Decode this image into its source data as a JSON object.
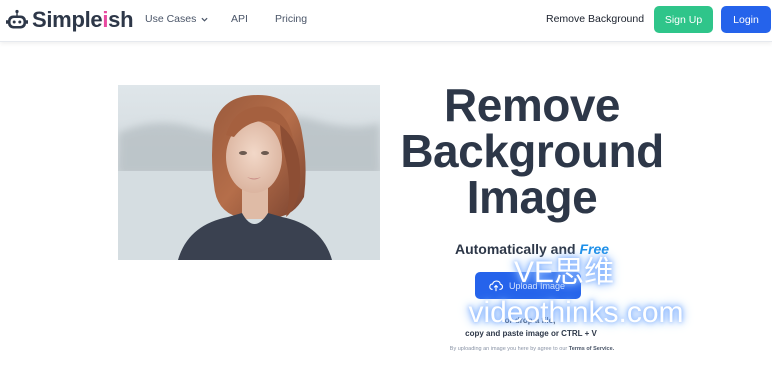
{
  "nav": {
    "logo_prefix": "Simple",
    "logo_i": "i",
    "logo_suffix": "sh",
    "use_cases": "Use Cases",
    "api": "API",
    "pricing": "Pricing",
    "remove_background": "Remove Background",
    "sign_up": "Sign Up",
    "login": "Login"
  },
  "hero": {
    "title_line1": "Remove",
    "title_line2": "Background",
    "title_line3": "Image",
    "subtitle_prefix": "Automatically and",
    "subtitle_free": "Free",
    "upload_label": "Upload Image",
    "or_text": "or drop a file,",
    "paste_text": "copy and paste image or CTRL + V",
    "terms_prefix": "By uploading an image you here by agree to our",
    "terms_link": "Terms of Service."
  },
  "watermark": {
    "line1": "VE思维",
    "line2": "videothinks.com"
  },
  "colors": {
    "signup": "#2fc58a",
    "login": "#2563eb",
    "accent_free": "#1d8fe8",
    "logo_i": "#e84aa0"
  },
  "icons": [
    "robot-logo-icon",
    "chevron-down-icon",
    "cloud-upload-icon"
  ]
}
